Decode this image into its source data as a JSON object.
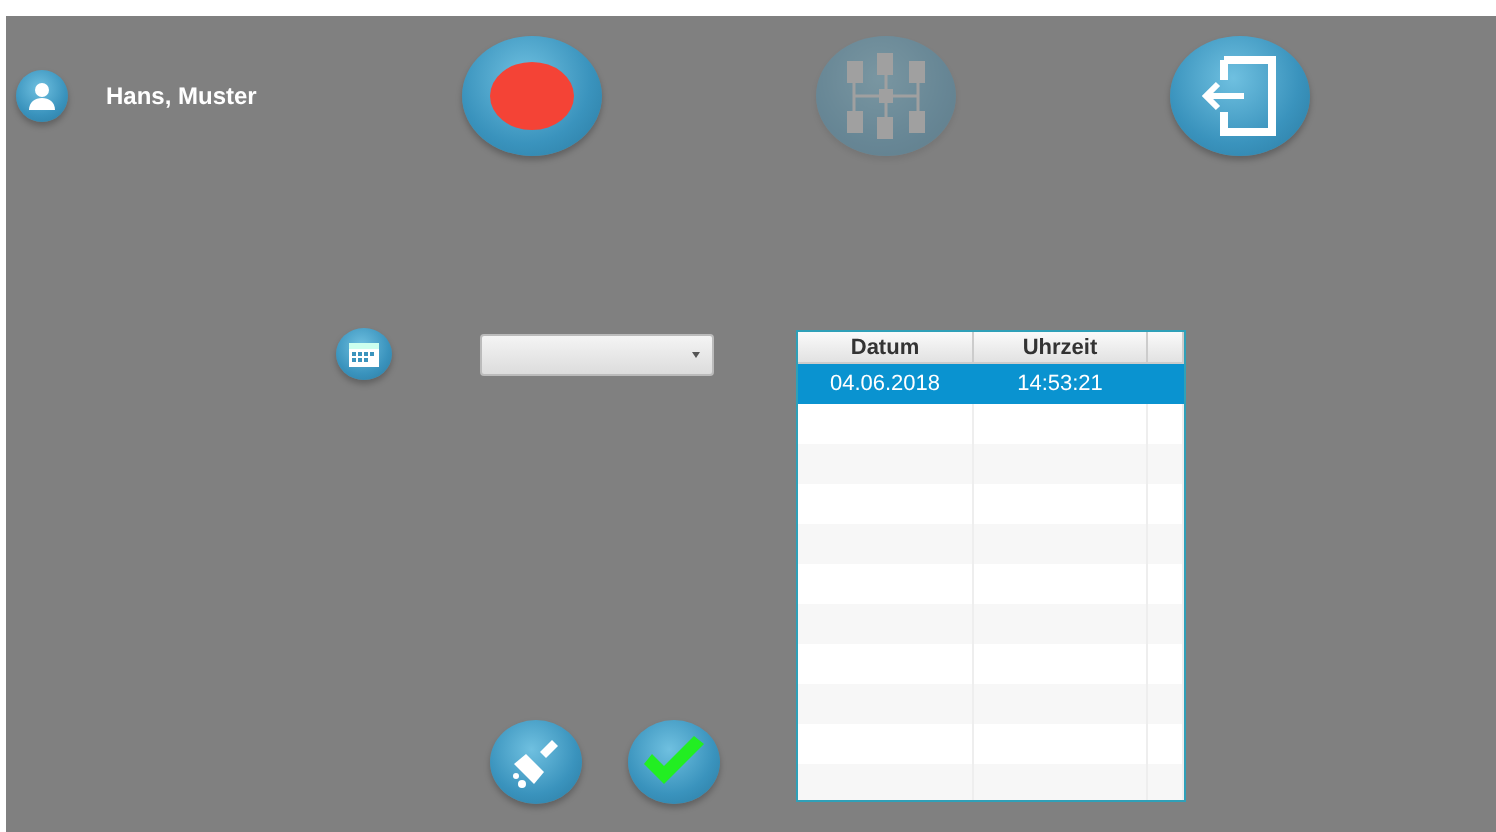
{
  "user": {
    "name": "Hans, Muster"
  },
  "toolbar": [
    {
      "kind": "record",
      "disabled": false
    },
    {
      "kind": "network",
      "disabled": true
    },
    {
      "kind": "exit",
      "disabled": false
    }
  ],
  "date_filter": {
    "kind": "dropdown"
  },
  "table": {
    "columns": [
      "Datum",
      "Uhrzeit"
    ],
    "rows": [
      {
        "cells": [
          "04.06.2018",
          "14:53:21"
        ],
        "selected": true
      }
    ]
  },
  "actions": [
    {
      "kind": "clear"
    },
    {
      "kind": "confirm"
    }
  ]
}
